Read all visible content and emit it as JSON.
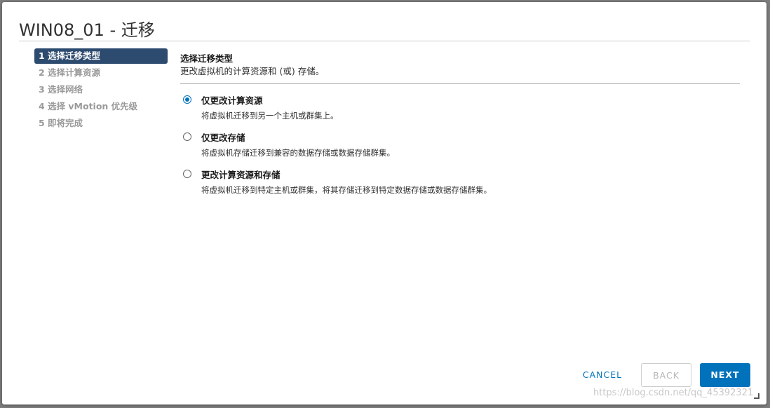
{
  "dialog": {
    "title": "WIN08_01 - 迁移"
  },
  "steps": [
    {
      "label": "1 选择迁移类型",
      "active": true
    },
    {
      "label": "2 选择计算资源",
      "active": false
    },
    {
      "label": "3 选择网络",
      "active": false
    },
    {
      "label": "4 选择 vMotion 优先级",
      "active": false
    },
    {
      "label": "5 即将完成",
      "active": false
    }
  ],
  "content": {
    "title": "选择迁移类型",
    "subtitle": "更改虚拟机的计算资源和 (或) 存储。",
    "options": [
      {
        "label": "仅更改计算资源",
        "description": "将虚拟机迁移到另一个主机或群集上。",
        "selected": true
      },
      {
        "label": "仅更改存储",
        "description": "将虚拟机存储迁移到兼容的数据存储或数据存储群集。",
        "selected": false
      },
      {
        "label": "更改计算资源和存储",
        "description": "将虚拟机迁移到特定主机或群集，将其存储迁移到特定数据存储或数据存储群集。",
        "selected": false
      }
    ]
  },
  "buttons": {
    "cancel": "CANCEL",
    "back": "BACK",
    "next": "NEXT"
  },
  "watermark": "https://blog.csdn.net/qq_45392321",
  "colors": {
    "accent": "#0072bc",
    "active_step": "#2d4a6f"
  }
}
